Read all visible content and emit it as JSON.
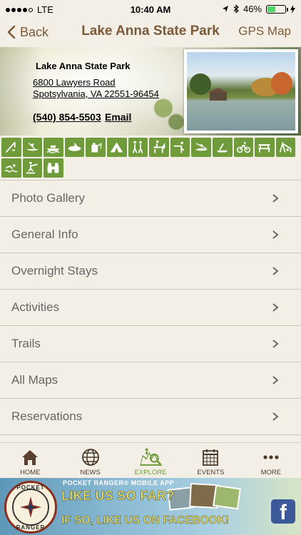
{
  "status_bar": {
    "carrier": "LTE",
    "time": "10:40 AM",
    "battery_percent": "46%",
    "battery_level": 0.46
  },
  "nav": {
    "back_label": "Back",
    "title": "Lake Anna State Park",
    "gps_label": "GPS Map"
  },
  "park": {
    "name": "Lake Anna State Park",
    "address_line1": "6800 Lawyers Road",
    "address_line2": "Spotsylvania, VA 22551-96454",
    "phone": "(540) 854-5503",
    "email_label": "Email"
  },
  "activities": [
    {
      "icon": "fishing-icon"
    },
    {
      "icon": "canoe-icon"
    },
    {
      "icon": "boat-launch-icon"
    },
    {
      "icon": "boat-rental-icon"
    },
    {
      "icon": "camping-fuel-icon"
    },
    {
      "icon": "tent-camping-icon"
    },
    {
      "icon": "hiking-icon"
    },
    {
      "icon": "horseback-riding-icon"
    },
    {
      "icon": "hunting-icon"
    },
    {
      "icon": "kayak-icon"
    },
    {
      "icon": "paddleboat-icon"
    },
    {
      "icon": "biking-icon"
    },
    {
      "icon": "picnic-table-icon"
    },
    {
      "icon": "playground-icon"
    },
    {
      "icon": "swimming-icon"
    },
    {
      "icon": "waterskiing-icon"
    },
    {
      "icon": "binoculars-icon"
    }
  ],
  "menu": [
    {
      "label": "Photo Gallery"
    },
    {
      "label": "General Info"
    },
    {
      "label": "Overnight Stays"
    },
    {
      "label": "Activities"
    },
    {
      "label": "Trails"
    },
    {
      "label": "All Maps"
    },
    {
      "label": "Reservations"
    }
  ],
  "tabs": [
    {
      "label": "HOME",
      "icon": "home-icon"
    },
    {
      "label": "NEWS",
      "icon": "globe-icon"
    },
    {
      "label": "EXPLORE",
      "icon": "explore-map-icon",
      "active": true
    },
    {
      "label": "EVENTS",
      "icon": "calendar-icon"
    },
    {
      "label": "MORE",
      "icon": "more-dots-icon"
    }
  ],
  "ad": {
    "compass_top": "POCKET",
    "compass_bottom": "RANGER",
    "app_tag": "POCKET RANGER® MOBILE APP",
    "line1": "LIKE US SO FAR?",
    "line2": "IF SO, LIKE US ON FACEBOOK!",
    "fb_letter": "f"
  },
  "colors": {
    "accent_brown": "#7b5a3a",
    "activity_green": "#6f9b3a",
    "background": "#f3efe6",
    "facebook_blue": "#3b5998"
  }
}
